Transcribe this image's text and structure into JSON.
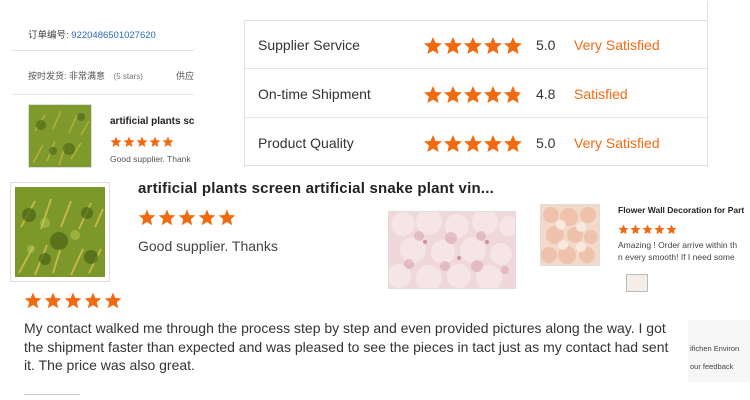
{
  "order_card": {
    "order_label": "订单编号:",
    "order_number": "9220486501027620",
    "shipping_label": "按时发货: 非常满意",
    "stars_count": "(5 stars)",
    "supplier_label": "供应商",
    "product_title": "artificial plants scr",
    "comment": "Good supplier. Thank"
  },
  "ratings": [
    {
      "label": "Supplier Service",
      "stars": 5,
      "score": "5.0",
      "verdict": "Very Satisfied"
    },
    {
      "label": "On-time Shipment",
      "stars": 4.8,
      "score": "4.8",
      "verdict": "Satisfied"
    },
    {
      "label": "Product Quality",
      "stars": 5,
      "score": "5.0",
      "verdict": "Very Satisfied"
    }
  ],
  "main_review": {
    "product_title": "artificial plants screen artificial snake plant vin...",
    "product_stars": 5,
    "comment": "Good supplier. Thanks",
    "review_stars": 5,
    "review_text": "My contact walked me through the process step by step and even provided pictures along the way. I got the shipment faster than expected and was pleased to see the pieces in tact just as my contact had sent it. The price was also great."
  },
  "side_review": {
    "product_title": "Flower Wall Decoration for Part",
    "stars": 5,
    "comment_line1": "Amazing ! Order arrive within th",
    "comment_line2": "n  every smooth! If I need some"
  },
  "right_crop": {
    "line1": "ifichen Environ",
    "line2": "our feedback"
  },
  "colors": {
    "star": "#f26a10",
    "verdict": "#f26a10",
    "order_number": "#2a6ab8"
  }
}
